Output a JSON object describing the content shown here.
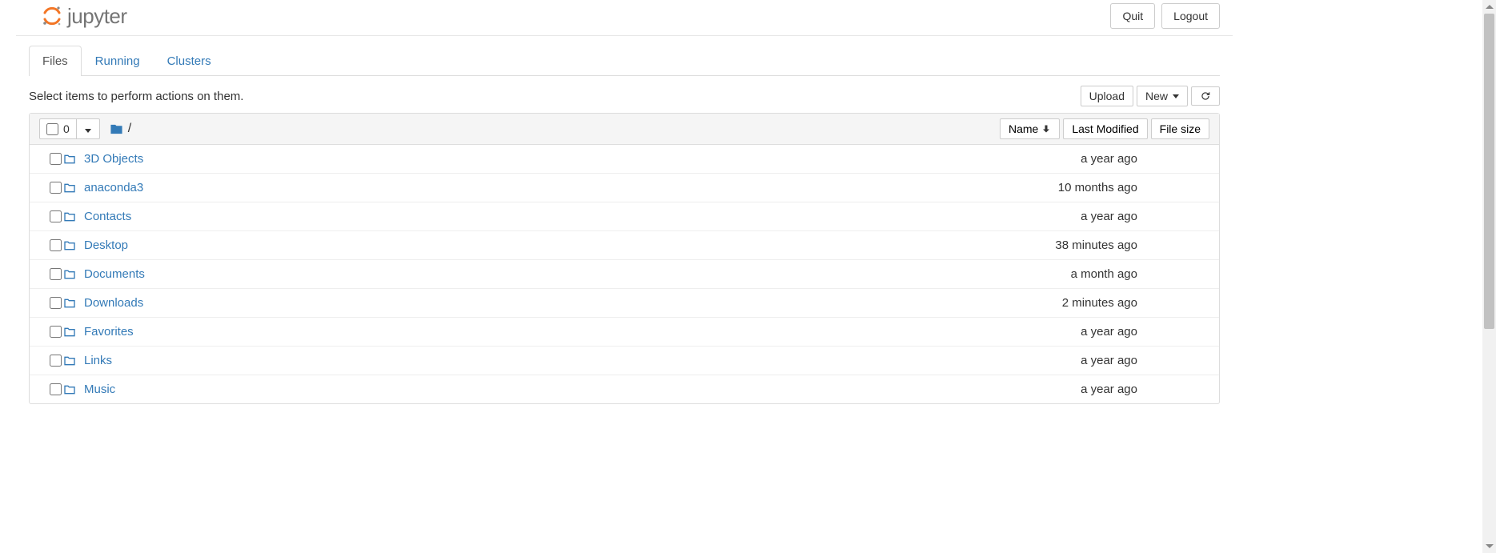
{
  "header": {
    "logo_text": "jupyter",
    "quit_label": "Quit",
    "logout_label": "Logout"
  },
  "tabs": [
    {
      "label": "Files",
      "active": true
    },
    {
      "label": "Running",
      "active": false
    },
    {
      "label": "Clusters",
      "active": false
    }
  ],
  "toolbar": {
    "hint": "Select items to perform actions on them.",
    "upload_label": "Upload",
    "new_label": "New"
  },
  "list_header": {
    "selected_count": "0",
    "breadcrumb_sep": "/",
    "col_name": "Name",
    "col_modified": "Last Modified",
    "col_size": "File size"
  },
  "rows": [
    {
      "name": "3D Objects",
      "modified": "a year ago",
      "size": ""
    },
    {
      "name": "anaconda3",
      "modified": "10 months ago",
      "size": ""
    },
    {
      "name": "Contacts",
      "modified": "a year ago",
      "size": ""
    },
    {
      "name": "Desktop",
      "modified": "38 minutes ago",
      "size": ""
    },
    {
      "name": "Documents",
      "modified": "a month ago",
      "size": ""
    },
    {
      "name": "Downloads",
      "modified": "2 minutes ago",
      "size": ""
    },
    {
      "name": "Favorites",
      "modified": "a year ago",
      "size": ""
    },
    {
      "name": "Links",
      "modified": "a year ago",
      "size": ""
    },
    {
      "name": "Music",
      "modified": "a year ago",
      "size": ""
    }
  ]
}
